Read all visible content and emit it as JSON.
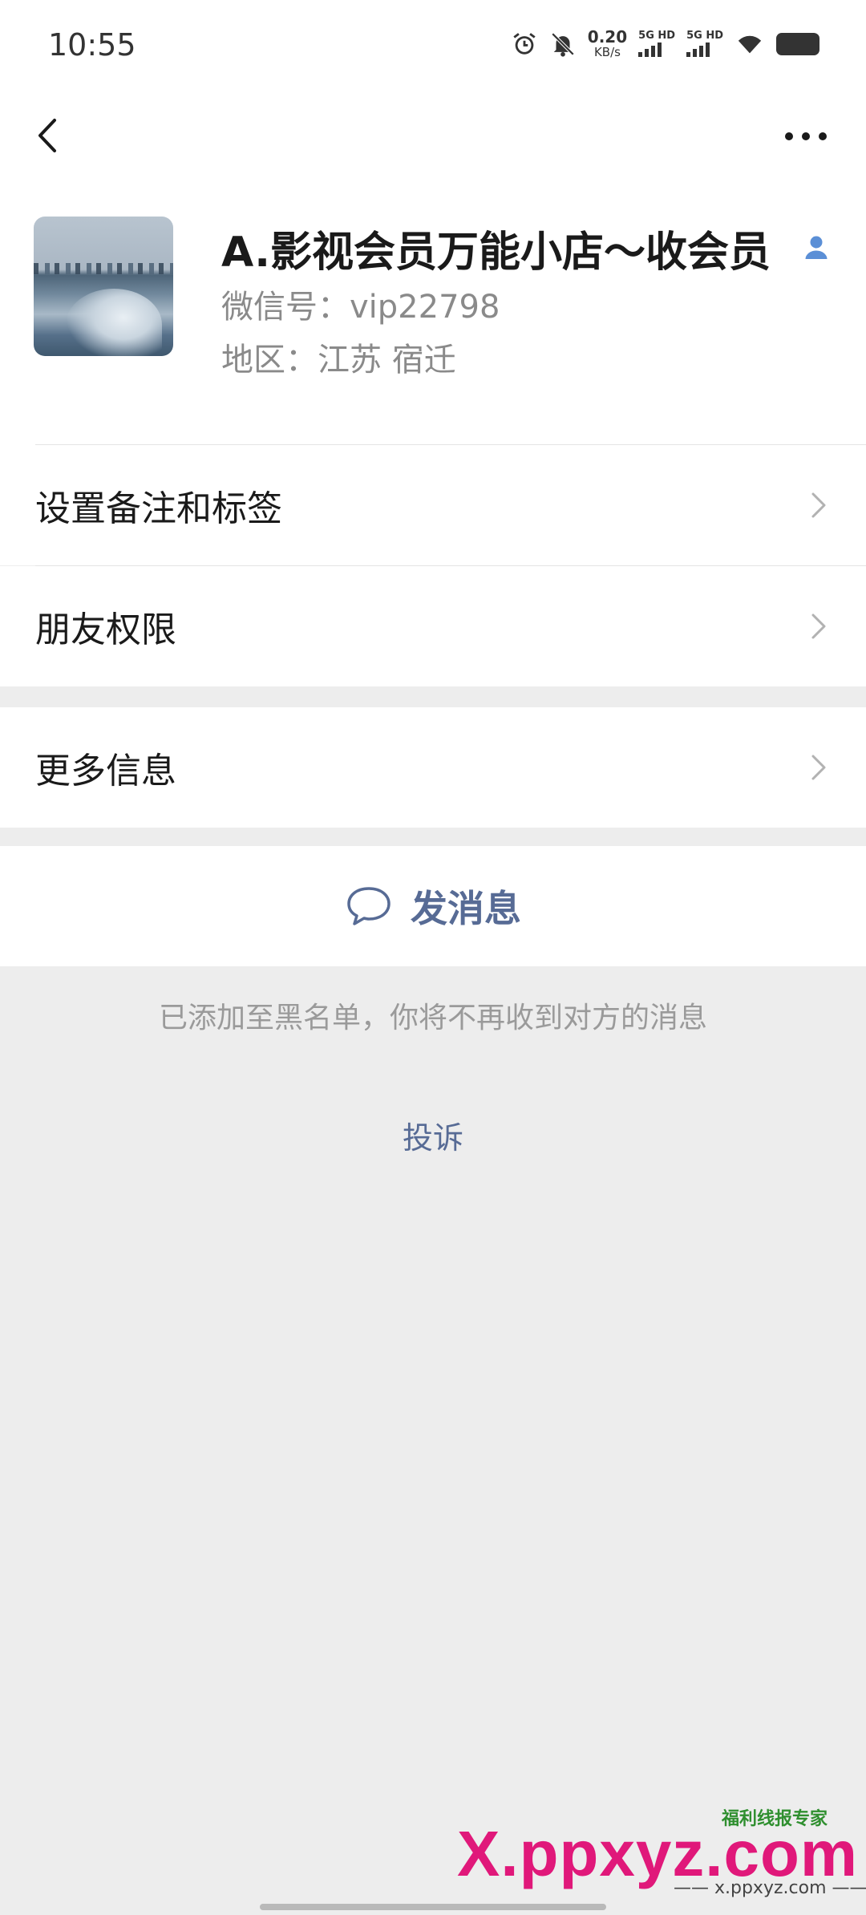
{
  "status_bar": {
    "time": "10:55",
    "net_speed_value": "0.20",
    "net_speed_unit": "KB/s",
    "sim1_label": "5G HD",
    "sim2_label": "5G HD"
  },
  "nav": {
    "back_icon": "chevron-left-icon",
    "more_icon": "more-dots-icon"
  },
  "profile": {
    "nickname": "A.影视会员万能小店～收会员",
    "wechat_id": "微信号：vip22798",
    "region": "地区：江苏  宿迁"
  },
  "menu": {
    "items": [
      {
        "label": "设置备注和标签"
      },
      {
        "label": "朋友权限"
      },
      {
        "label": "更多信息"
      }
    ]
  },
  "actions": {
    "send_message": "发消息"
  },
  "notice": {
    "blocked_text": "已添加至黑名单，你将不再收到对方的消息",
    "complaint": "投诉"
  },
  "watermark": {
    "brand_small": "福利线报专家",
    "logo": "X.ppxyz.com",
    "url": "—— x.ppxyz.com ——"
  },
  "colors": {
    "accent_link": "#576b95",
    "background": "#ededed",
    "watermark": "#e0187a"
  }
}
